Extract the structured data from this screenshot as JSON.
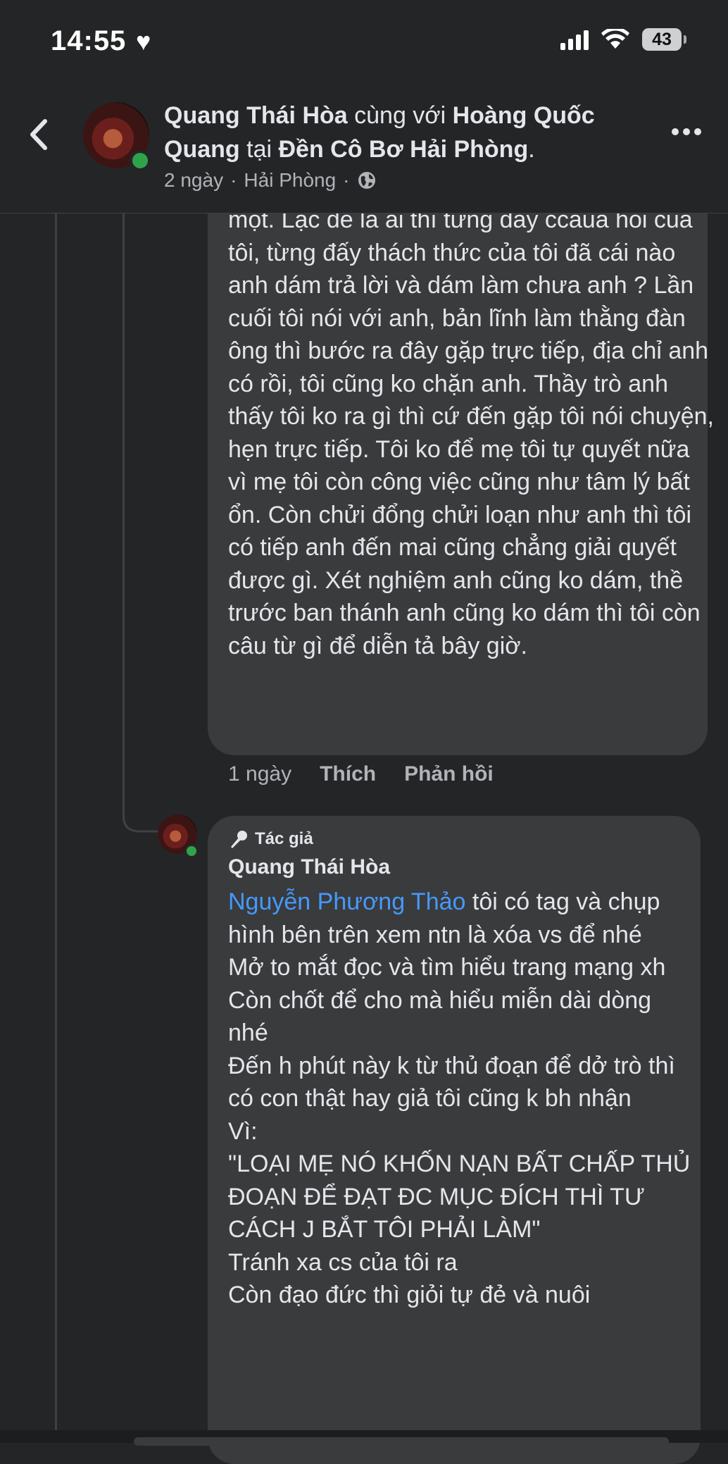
{
  "status_bar": {
    "time": "14:55",
    "battery": "43"
  },
  "header": {
    "author": "Quang Thái Hòa",
    "with_word": " cùng với ",
    "tagged": "Hoàng Quốc Quang",
    "at_word": " tại ",
    "location": "Đền Cô Bơ Hải Phòng",
    "period": ".",
    "time": "2 ngày",
    "place": "Hải Phòng",
    "sep": "·"
  },
  "comment1": {
    "text": "một. Lạc đề là ai thì từng đấy ccaua hỏi của tôi, từng đấy thách thức của tôi đã cái nào anh dám trả lời và dám làm chưa anh ? Lần cuối tôi nói với anh, bản lĩnh làm thằng đàn ông thì bước ra đây gặp trực tiếp, địa chỉ anh có rồi, tôi cũng ko chặn anh. Thầy trò anh thấy tôi ko ra gì thì cứ đến gặp tôi nói chuyện, hẹn trực tiếp. Tôi ko để mẹ tôi tự quyết nữa vì mẹ tôi còn công việc cũng như tâm lý bất ổn. Còn chửi đổng chửi loạn như anh thì tôi có tiếp anh đến mai cũng chẳng giải quyết được gì. Xét nghiệm anh cũng ko dám, thề trước ban thánh anh cũng ko dám thì tôi còn câu từ gì để diễn tả bây giờ.",
    "time": "1 ngày",
    "like": "Thích",
    "reply": "Phản hồi"
  },
  "comment2": {
    "badge": "Tác giả",
    "name": "Quang Thái Hòa",
    "mention": "Nguyễn Phương Thảo",
    "text": " tôi có tag và chụp hình bên trên xem ntn là xóa vs để nhé\nMở to mắt đọc và tìm hiểu trang mạng xh\nCòn chốt để cho mà hiểu miễn dài dòng nhé\nĐến h phút này k từ thủ đoạn để dở trò thì có con thật hay giả tôi cũng k bh nhận\nVì:\n\"LOẠI MẸ NÓ KHỐN NẠN BẤT CHẤP THỦ ĐOẠN ĐỂ ĐẠT ĐC MỤC ĐÍCH THÌ TƯ CÁCH J BẮT TÔI PHẢI LÀM\"\nTránh xa cs của tôi ra\nCòn đạo đức thì giỏi tự đẻ và nuôi"
  },
  "colors": {
    "background": "#242526",
    "bubble": "#3a3b3c",
    "mention": "#4599ff",
    "online": "#31a24c"
  }
}
